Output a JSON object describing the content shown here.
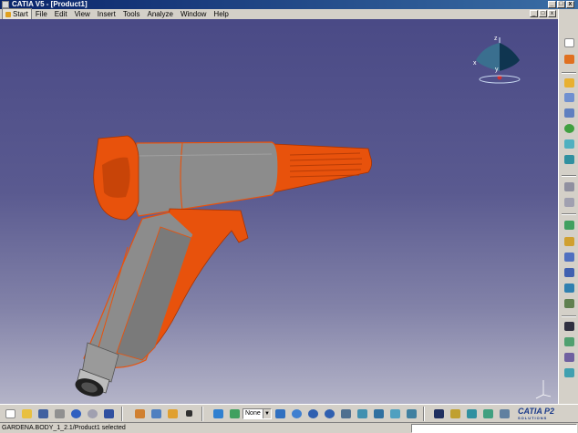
{
  "window": {
    "title": "CATIA V5 - [Product1]",
    "min_label": "_",
    "max_label": "□",
    "close_label": "x"
  },
  "menu": {
    "items": [
      "Start",
      "File",
      "Edit",
      "View",
      "Insert",
      "Tools",
      "Analyze",
      "Window",
      "Help"
    ],
    "doc_min": "_",
    "doc_max": "□",
    "doc_close": "x"
  },
  "compass": {
    "x_label": "x",
    "y_label": "y",
    "z_label": "z"
  },
  "toolbar_bottom": {
    "render_mode": "None",
    "brand_name": "CATIA P2",
    "brand_sub": "SOLUTIONS"
  },
  "status": {
    "text": "GARDENA.BODY_1_2.1/Product1 selected",
    "command_value": ""
  },
  "colors": {
    "accent_orange": "#e8520c",
    "body_gray": "#8a8a8a",
    "background_top": "#4a4a86",
    "background_bottom": "#b4b4c8"
  },
  "icons": {
    "right_toolbar": [
      "select-icon",
      "sketcher-icon",
      "plane-icon",
      "snap-icon",
      "compass-icon",
      "constraint-icon",
      "assembly-icon",
      "manipulate-icon",
      "explode-icon",
      "clash-icon",
      "section-icon",
      "measure-icon",
      "bom-icon",
      "annotation-icon",
      "scene-icon",
      "catalog-icon",
      "binoculars-icon",
      "catalog-browser-icon",
      "render-icon"
    ],
    "bottom_toolbar": [
      "new-icon",
      "open-icon",
      "save-icon",
      "print-icon",
      "undo-icon",
      "redo-icon",
      "help-icon",
      "select-icon",
      "product-icon",
      "fly-mode-icon",
      "fit-all-icon",
      "pan-icon",
      "rotate-icon",
      "zoom-in-icon",
      "zoom-out-icon",
      "normal-view-icon",
      "iso-view-icon",
      "shading-icon",
      "hide-show-icon",
      "swap-icon",
      "lights-icon"
    ]
  }
}
